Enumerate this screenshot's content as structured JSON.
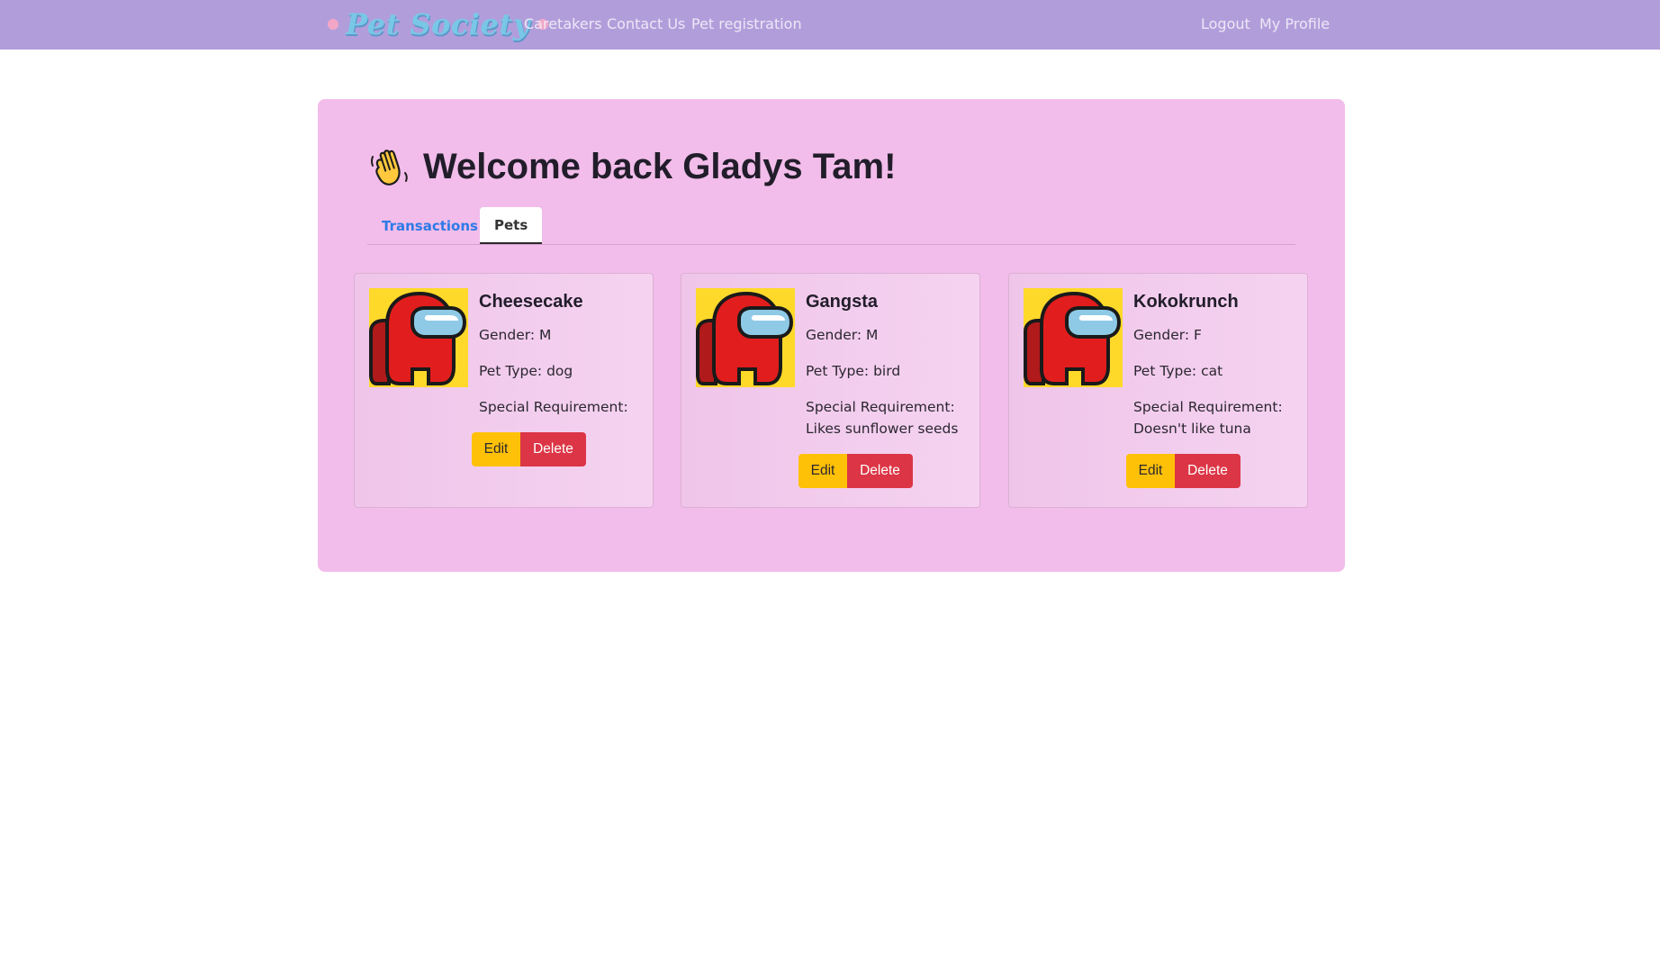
{
  "nav": {
    "brand": "Pet Society",
    "links": [
      "Caretakers",
      "Contact Us",
      "Pet registration"
    ],
    "right_links": [
      "Logout",
      "My Profile"
    ]
  },
  "main": {
    "welcome_icon": "waving-hand-icon",
    "welcome_text": "Welcome back Gladys Tam!",
    "tabs": [
      {
        "label": "Transactions",
        "active": false
      },
      {
        "label": "Pets",
        "active": true
      }
    ]
  },
  "pets": [
    {
      "name": "Cheesecake",
      "gender": "Gender: M",
      "type": "Pet Type: dog",
      "requirement_label": "Special Requirement:",
      "requirement": "",
      "avatar": "crewmate-avatar-icon"
    },
    {
      "name": "Gangsta",
      "gender": "Gender: M",
      "type": "Pet Type: bird",
      "requirement_label": "Special Requirement:",
      "requirement": "Likes sunflower seeds",
      "avatar": "crewmate-avatar-icon"
    },
    {
      "name": "Kokokrunch",
      "gender": "Gender: F",
      "type": "Pet Type: cat",
      "requirement_label": "Special Requirement:",
      "requirement": "Doesn't like tuna",
      "avatar": "crewmate-avatar-icon"
    }
  ],
  "buttons": {
    "edit": "Edit",
    "delete": "Delete"
  },
  "colors": {
    "navbar": "#b29ddb",
    "panel": "#f2bdea",
    "edit_button": "#ffc107",
    "delete_button": "#dc3545",
    "avatar_background": "#ffd92a",
    "active_tab_link": "#2e7ae6"
  }
}
